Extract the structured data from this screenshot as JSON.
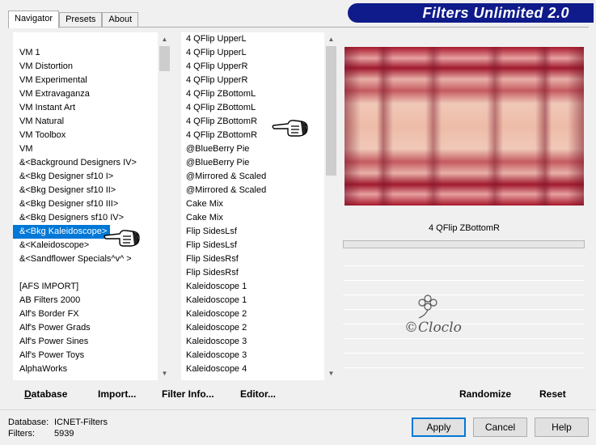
{
  "tabs": [
    {
      "label": "Navigator",
      "active": true
    },
    {
      "label": "Presets",
      "active": false
    },
    {
      "label": "About",
      "active": false
    }
  ],
  "banner": {
    "title": "Filters Unlimited 2.0",
    "color": "#0f1b8a"
  },
  "categories": {
    "items": [
      "",
      "VM 1",
      "VM Distortion",
      "VM Experimental",
      "VM Extravaganza",
      "VM Instant Art",
      "VM Natural",
      "VM Toolbox",
      "VM",
      "&<Background Designers IV>",
      "&<Bkg Designer sf10 I>",
      "&<Bkg Designer sf10 II>",
      "&<Bkg Designer sf10 III>",
      "&<Bkg Designers sf10 IV>",
      "&<Bkg Kaleidoscope>",
      "&<Kaleidoscope>",
      "&<Sandflower Specials^v^ >",
      "",
      "[AFS IMPORT]",
      "AB Filters 2000",
      "Alf's Border FX",
      "Alf's Power Grads",
      "Alf's Power Sines",
      "Alf's Power Toys",
      "AlphaWorks"
    ],
    "selected_index": 14
  },
  "filters": {
    "items": [
      "4 QFlip UpperL",
      "4 QFlip UpperL",
      "4 QFlip UpperR",
      "4 QFlip UpperR",
      "4 QFlip ZBottomL",
      "4 QFlip ZBottomL",
      "4 QFlip ZBottomR",
      "4 QFlip ZBottomR",
      "@BlueBerry Pie",
      "@BlueBerry Pie",
      "@Mirrored & Scaled",
      "@Mirrored & Scaled",
      "Cake Mix",
      "Cake Mix",
      "Flip SidesLsf",
      "Flip SidesLsf",
      "Flip SidesRsf",
      "Flip SidesRsf",
      "Kaleidoscope 1",
      "Kaleidoscope 1",
      "Kaleidoscope 2",
      "Kaleidoscope 2",
      "Kaleidoscope 3",
      "Kaleidoscope 3",
      "Kaleidoscope 4"
    ]
  },
  "preview": {
    "caption": "4 QFlip ZBottomR",
    "watermark": "©Cloclo"
  },
  "bottom_buttons": {
    "database": "Database",
    "import": "Import...",
    "filter_info": "Filter Info...",
    "editor": "Editor...",
    "randomize": "Randomize",
    "reset": "Reset"
  },
  "info": {
    "database_label": "Database:",
    "database_value": "ICNET-Filters",
    "filters_label": "Filters:",
    "filters_value": "5939"
  },
  "dialog_buttons": {
    "apply": "Apply",
    "cancel": "Cancel",
    "help": "Help"
  },
  "colors": {
    "selection": "#0078d7",
    "window": "#f0f0f0",
    "accent_border": "#0078d7"
  },
  "icons": {
    "scroll_up": "chevron-up-icon",
    "scroll_down": "chevron-down-icon",
    "pointer": "pointing-hand-icon"
  }
}
